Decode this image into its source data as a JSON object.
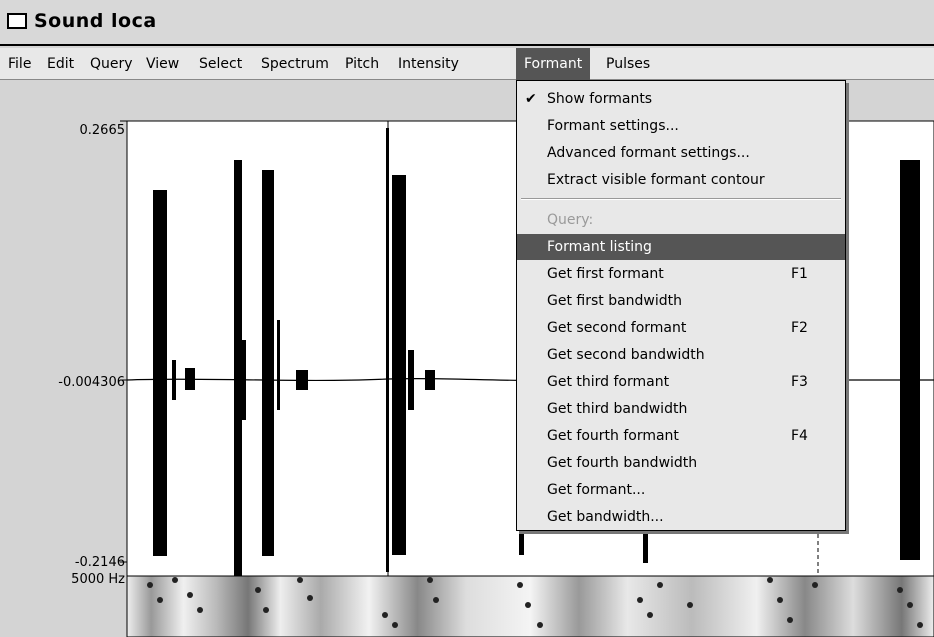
{
  "window": {
    "title": "Sound loca"
  },
  "menubar": {
    "items": [
      "File",
      "Edit",
      "Query",
      "View",
      "Select",
      "Spectrum",
      "Pitch",
      "Intensity",
      "Formant",
      "Pulses"
    ],
    "active": "Formant"
  },
  "waveform": {
    "y_max": "0.2665",
    "y_mid": "-0.004306",
    "y_min": "-0.2146",
    "spectrogram_top": "5000 Hz"
  },
  "formant_menu": {
    "items": [
      {
        "label": "Show formants",
        "checked": true
      },
      {
        "label": "Formant settings..."
      },
      {
        "label": "Advanced formant settings..."
      },
      {
        "label": "Extract visible formant contour"
      },
      {
        "separator": true
      },
      {
        "label": "Query:",
        "disabled": true
      },
      {
        "label": "Formant listing",
        "highlighted": true
      },
      {
        "label": "Get first formant",
        "shortcut": "F1"
      },
      {
        "label": "Get first bandwidth"
      },
      {
        "label": "Get second formant",
        "shortcut": "F2"
      },
      {
        "label": "Get second bandwidth"
      },
      {
        "label": "Get third formant",
        "shortcut": "F3"
      },
      {
        "label": "Get third bandwidth"
      },
      {
        "label": "Get fourth formant",
        "shortcut": "F4"
      },
      {
        "label": "Get fourth bandwidth"
      },
      {
        "label": "Get formant..."
      },
      {
        "label": "Get bandwidth..."
      }
    ]
  },
  "colors": {
    "highlight": "#555555",
    "menu_bg": "#e8e8e8",
    "disabled": "#9a9a9a"
  }
}
